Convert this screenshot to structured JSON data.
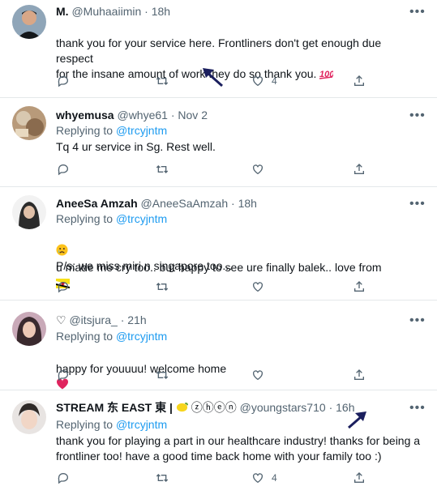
{
  "tweets": [
    {
      "name": "M.",
      "handle": "@Muhaaiimin",
      "sep": "·",
      "time": "18h",
      "text": "thank you for your service here. Frontliners don't get enough due respect\nfor the insane amount of work they do so thank you.",
      "like_count": "4"
    },
    {
      "name": "whyemusa",
      "handle": "@whye61",
      "sep": "·",
      "time": "Nov 2",
      "replying_prefix": "Replying to",
      "replying_to": "@trcyjntm",
      "text": "Tq 4 ur service in Sg. Rest well."
    },
    {
      "name": "AneeSa Amzah",
      "handle": "@AneeSaAmzah",
      "sep": "·",
      "time": "18h",
      "replying_prefix": "Replying to",
      "replying_to": "@trcyjntm",
      "text_line1": "u made me cry too.. but happy to see ure finally balek.. love from",
      "text_line2": "P/s: we miss miri n singapore too..."
    },
    {
      "name": "♡",
      "handle": "@itsjura_",
      "sep": "·",
      "time": "21h",
      "replying_prefix": "Replying to",
      "replying_to": "@trcyjntm",
      "text": "happy for youuuu! welcome home"
    },
    {
      "name": "STREAM 东 EAST 東 |",
      "name_suffix": "ⓩⓗⓔⓝ",
      "handle": "@youngstars710",
      "sep": "·",
      "time": "16h",
      "replying_prefix": "Replying to",
      "replying_to": "@trcyjntm",
      "text": "thank you for playing a part in our healthcare industry! thanks for being a\nfrontliner too! have a good time back home with your family too :)",
      "like_count": "4"
    }
  ],
  "icons": {
    "reply": "reply-icon",
    "retweet": "retweet-icon",
    "like": "heart-icon",
    "share": "share-icon",
    "more": "more-icon"
  },
  "colors": {
    "accent": "#1d9bf0",
    "muted": "#536471",
    "text": "#0f1419",
    "divider": "#e4e8ea",
    "annotation_arrow": "#1b1f5e"
  }
}
